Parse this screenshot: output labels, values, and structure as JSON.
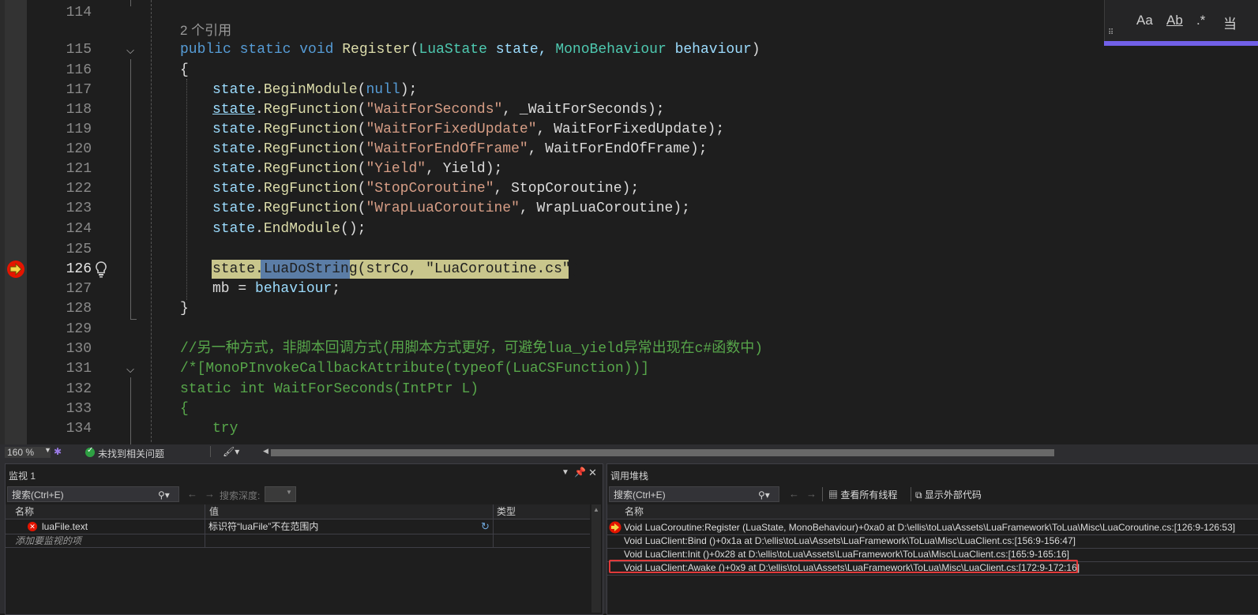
{
  "editor": {
    "zoom": "160 %",
    "issues_status": "未找到相关问题",
    "find_panel": {
      "match_case": "Aa",
      "match_word": "Ab",
      "regex": ".*",
      "current": "当"
    },
    "lines": [
      {
        "n": "114",
        "code": ""
      },
      {
        "n": "115",
        "refs": "2 个引用",
        "code": ""
      },
      {
        "n": "116",
        "code": ""
      },
      {
        "n": "117",
        "code": ""
      },
      {
        "n": "118",
        "code": ""
      },
      {
        "n": "119",
        "code": ""
      },
      {
        "n": "120",
        "code": ""
      },
      {
        "n": "121",
        "code": ""
      },
      {
        "n": "122",
        "code": ""
      },
      {
        "n": "123",
        "code": ""
      },
      {
        "n": "124",
        "code": ""
      },
      {
        "n": "125",
        "code": ""
      },
      {
        "n": "126",
        "code": ""
      },
      {
        "n": "127",
        "code": ""
      },
      {
        "n": "128",
        "code": ""
      },
      {
        "n": "129",
        "code": ""
      },
      {
        "n": "130",
        "code": ""
      },
      {
        "n": "131",
        "code": ""
      },
      {
        "n": "132",
        "code": ""
      },
      {
        "n": "133",
        "code": ""
      },
      {
        "n": "134",
        "code": ""
      }
    ],
    "tokens": {
      "l115": [
        "public",
        " static",
        " void",
        " Register",
        "(",
        "LuaState",
        " state, ",
        "MonoBehaviour",
        " behaviour",
        ")"
      ],
      "l116": "{",
      "l117": [
        "state",
        ".",
        "BeginModule",
        "(",
        "null",
        ");"
      ],
      "l118": [
        "state",
        ".",
        "RegFunction",
        "(",
        "\"WaitForSeconds\"",
        ", _WaitForSeconds);"
      ],
      "l119": [
        "state",
        ".",
        "RegFunction",
        "(",
        "\"WaitForFixedUpdate\"",
        ", WaitForFixedUpdate);"
      ],
      "l120": [
        "state",
        ".",
        "RegFunction",
        "(",
        "\"WaitForEndOfFrame\"",
        ", WaitForEndOfFrame);"
      ],
      "l121": [
        "state",
        ".",
        "RegFunction",
        "(",
        "\"Yield\"",
        ", Yield);"
      ],
      "l122": [
        "state",
        ".",
        "RegFunction",
        "(",
        "\"StopCoroutine\"",
        ", StopCoroutine);"
      ],
      "l123": [
        "state",
        ".",
        "RegFunction",
        "(",
        "\"WrapLuaCoroutine\"",
        ", WrapLuaCoroutine);"
      ],
      "l124": [
        "state",
        ".",
        "EndModule",
        "();"
      ],
      "l126": [
        "state",
        ".",
        "LuaDoString",
        "(strCo, ",
        "\"LuaCoroutine.cs\"",
        ");"
      ],
      "l127": [
        "mb",
        " = ",
        "behaviour",
        ";"
      ],
      "l128": "}",
      "l130": "//另一种方式，非脚本回调方式(用脚本方式更好，可避免lua_yield异常出现在c#函数中)",
      "l131": "/*[MonoPInvokeCallbackAttribute(typeof(LuaCSFunction))]",
      "l132": "static int WaitForSeconds(IntPtr L)",
      "l133": "{",
      "l134": "try"
    }
  },
  "watch": {
    "title": "监视 1",
    "search_placeholder": "搜索(Ctrl+E)",
    "search_depth_label": "搜索深度:",
    "columns": [
      "名称",
      "值",
      "类型"
    ],
    "rows": [
      {
        "name": "luaFile.text",
        "value": "标识符“luaFile”不在范围内",
        "type": ""
      }
    ],
    "add_item": "添加要监视的项"
  },
  "callstack": {
    "title": "调用堆栈",
    "search_placeholder": "搜索(Ctrl+E)",
    "view_threads": "查看所有线程",
    "show_external": "显示外部代码",
    "column": "名称",
    "frames": [
      "Void LuaCoroutine:Register (LuaState, MonoBehaviour)+0xa0 at D:\\ellis\\toLua\\Assets\\LuaFramework\\ToLua\\Misc\\LuaCoroutine.cs:[126:9-126:53]",
      "Void LuaClient:Bind ()+0x1a at D:\\ellis\\toLua\\Assets\\LuaFramework\\ToLua\\Misc\\LuaClient.cs:[156:9-156:47]",
      "Void LuaClient:Init ()+0x28 at D:\\ellis\\toLua\\Assets\\LuaFramework\\ToLua\\Misc\\LuaClient.cs:[165:9-165:16]",
      "Void LuaClient:Awake ()+0x9 at D:\\ellis\\toLua\\Assets\\LuaFramework\\ToLua\\Misc\\LuaClient.cs:[172:9-172:16]"
    ]
  }
}
